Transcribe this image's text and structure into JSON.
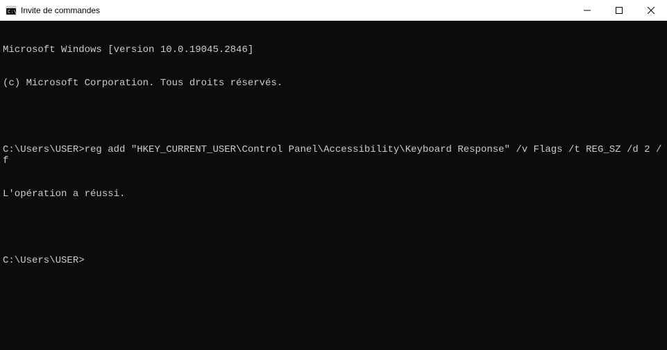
{
  "titlebar": {
    "title": "Invite de commandes"
  },
  "terminal": {
    "line1": "Microsoft Windows [version 10.0.19045.2846]",
    "line2": "(c) Microsoft Corporation. Tous droits réservés.",
    "blank1": "",
    "prompt1": "C:\\Users\\USER>",
    "command1": "reg add \"HKEY_CURRENT_USER\\Control Panel\\Accessibility\\Keyboard Response\" /v Flags /t REG_SZ /d 2 /f",
    "result1": "L'opération a réussi.",
    "blank2": "",
    "prompt2": "C:\\Users\\USER>"
  }
}
